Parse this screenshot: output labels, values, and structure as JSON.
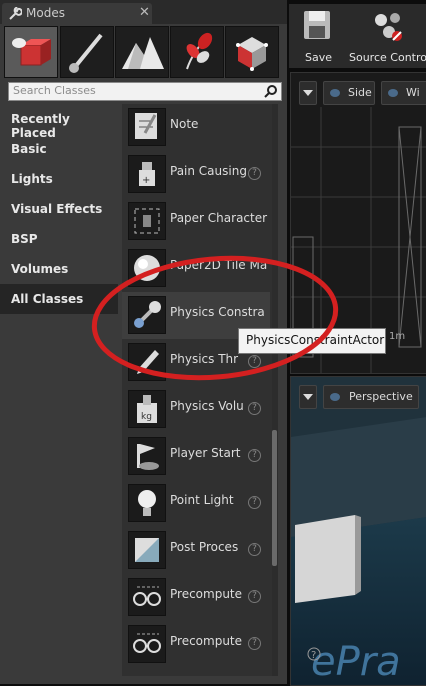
{
  "window": {
    "title": "Modes",
    "close_glyph": "✕"
  },
  "mode_tabs": [
    {
      "name": "place-mode-icon",
      "active": true
    },
    {
      "name": "paint-brush-icon",
      "active": false
    },
    {
      "name": "landscape-icon",
      "active": false
    },
    {
      "name": "foliage-icon",
      "active": false
    },
    {
      "name": "geometry-edit-icon",
      "active": false
    }
  ],
  "search": {
    "placeholder": "Search Classes"
  },
  "categories": [
    {
      "label": "Recently Placed",
      "active": false
    },
    {
      "label": "Basic",
      "active": false
    },
    {
      "label": "Lights",
      "active": false
    },
    {
      "label": "Visual Effects",
      "active": false
    },
    {
      "label": "BSP",
      "active": false
    },
    {
      "label": "Volumes",
      "active": false
    },
    {
      "label": "All Classes",
      "active": true
    }
  ],
  "class_list": [
    {
      "label": "Note",
      "icon": "note-icon",
      "help": false
    },
    {
      "label": "Pain Causing",
      "icon": "pain-volume-icon",
      "help": true
    },
    {
      "label": "Paper Character",
      "icon": "paper-character-icon",
      "help": false
    },
    {
      "label": "Paper2D Tile Ma",
      "icon": "sphere-icon",
      "help": false
    },
    {
      "label": "Physics Constra",
      "icon": "physics-constraint-icon",
      "help": false,
      "hover": true
    },
    {
      "label": "Physics Thr",
      "icon": "physics-thruster-icon",
      "help": true
    },
    {
      "label": "Physics Volu",
      "icon": "physics-volume-icon",
      "help": true
    },
    {
      "label": "Player Start",
      "icon": "player-start-icon",
      "help": true
    },
    {
      "label": "Point Light",
      "icon": "point-light-icon",
      "help": true
    },
    {
      "label": "Post Proces",
      "icon": "post-process-icon",
      "help": true
    },
    {
      "label": "Precompute",
      "icon": "precomputed-visibility-icon",
      "help": true
    },
    {
      "label": "Precompute",
      "icon": "precomputed-visibility-icon",
      "help": true
    }
  ],
  "help_glyph": "?",
  "toolbar": {
    "save_label": "Save",
    "source_control_label": "Source Contro"
  },
  "viewport_top": {
    "view_label": "Side",
    "wire_label": "Wi",
    "scale_label": "1m"
  },
  "viewport_bottom": {
    "view_label": "Perspective"
  },
  "tooltip": {
    "text": "PhysicsConstraintActor"
  },
  "colors": {
    "annotation_circle": "#d42020",
    "panel": "#3a3a3a",
    "list_bg": "#303030"
  }
}
